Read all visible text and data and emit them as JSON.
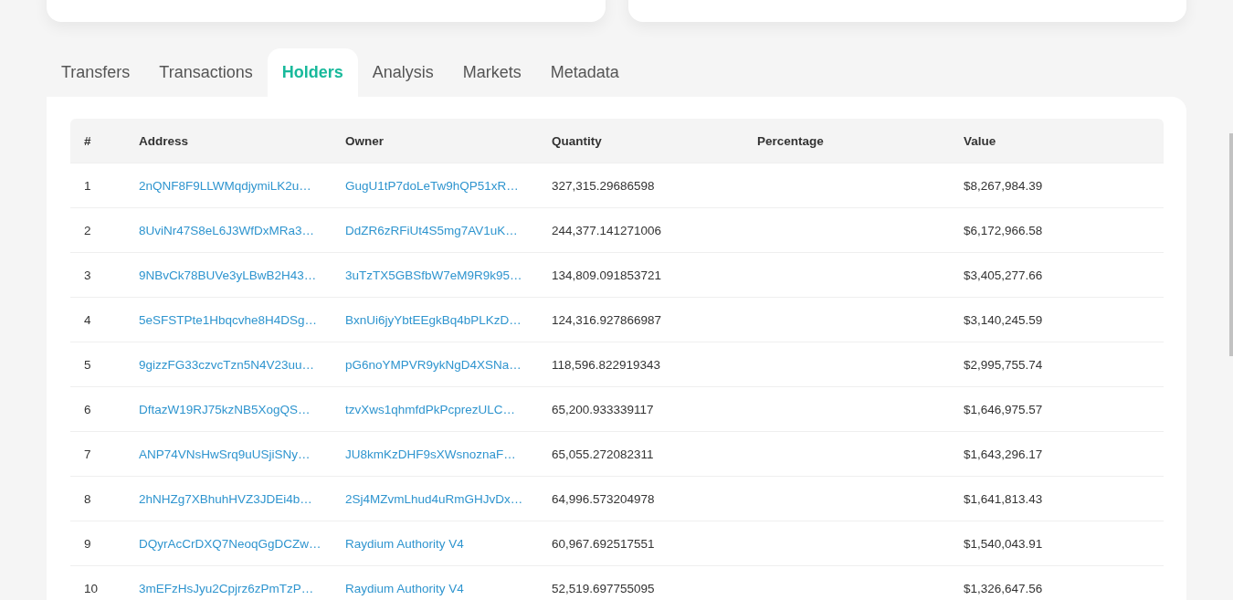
{
  "tabs": [
    {
      "label": "Transfers",
      "selected": false
    },
    {
      "label": "Transactions",
      "selected": false
    },
    {
      "label": "Holders",
      "selected": true
    },
    {
      "label": "Analysis",
      "selected": false
    },
    {
      "label": "Markets",
      "selected": false
    },
    {
      "label": "Metadata",
      "selected": false
    }
  ],
  "table": {
    "columns": [
      "#",
      "Address",
      "Owner",
      "Quantity",
      "Percentage",
      "Value"
    ],
    "rows": [
      {
        "rank": "1",
        "address": "2nQNF8F9LLWMqdjymiLK2u…",
        "owner": "GugU1tP7doLeTw9hQP51xR…",
        "quantity": "327,315.29686598",
        "value": "$8,267,984.39"
      },
      {
        "rank": "2",
        "address": "8UviNr47S8eL6J3WfDxMRa3…",
        "owner": "DdZR6zRFiUt4S5mg7AV1uK…",
        "quantity": "244,377.141271006",
        "value": "$6,172,966.58"
      },
      {
        "rank": "3",
        "address": "9NBvCk78BUVe3yLBwB2H43…",
        "owner": "3uTzTX5GBSfbW7eM9R9k95…",
        "quantity": "134,809.091853721",
        "value": "$3,405,277.66"
      },
      {
        "rank": "4",
        "address": "5eSFSTPte1Hbqcvhe8H4DSg…",
        "owner": "BxnUi6jyYbtEEgkBq4bPLKzD…",
        "quantity": "124,316.927866987",
        "value": "$3,140,245.59"
      },
      {
        "rank": "5",
        "address": "9gizzFG33czvcTzn5N4V23uu…",
        "owner": "pG6noYMPVR9ykNgD4XSNa…",
        "quantity": "118,596.822919343",
        "value": "$2,995,755.74"
      },
      {
        "rank": "6",
        "address": "DftazW19RJ75kzNB5XogQS…",
        "owner": "tzvXws1qhmfdPkPcprezULC…",
        "quantity": "65,200.933339117",
        "value": "$1,646,975.57"
      },
      {
        "rank": "7",
        "address": "ANP74VNsHwSrq9uUSjiSNy…",
        "owner": "JU8kmKzDHF9sXWsnoznaF…",
        "quantity": "65,055.272082311",
        "value": "$1,643,296.17"
      },
      {
        "rank": "8",
        "address": "2hNHZg7XBhuhHVZ3JDEi4b…",
        "owner": "2Sj4MZvmLhud4uRmGHJvDx…",
        "quantity": "64,996.573204978",
        "value": "$1,641,813.43"
      },
      {
        "rank": "9",
        "address": "DQyrAcCrDXQ7NeoqGgDCZw…",
        "owner": "Raydium Authority V4",
        "quantity": "60,967.692517551",
        "value": "$1,540,043.91"
      },
      {
        "rank": "10",
        "address": "3mEFzHsJyu2Cpjrz6zPmTzP…",
        "owner": "Raydium Authority V4",
        "quantity": "52,519.697755095",
        "value": "$1,326,647.56"
      }
    ]
  }
}
